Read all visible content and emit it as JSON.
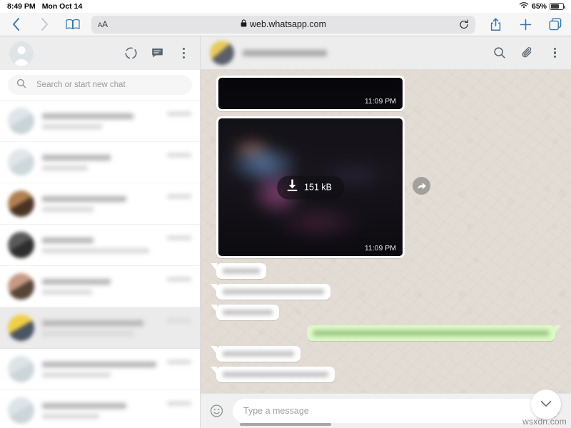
{
  "status_bar": {
    "time": "8:49 PM",
    "date": "Mon Oct 14",
    "battery_percent": "65%",
    "wifi_icon": "wifi-icon",
    "battery_icon": "battery-icon"
  },
  "browser": {
    "back_icon": "chevron-left-icon",
    "forward_icon": "chevron-right-icon",
    "bookmarks_icon": "book-icon",
    "text_size_label": "AA",
    "lock_icon": "lock-icon",
    "url": "web.whatsapp.com",
    "reload_icon": "reload-icon",
    "share_icon": "share-icon",
    "new_tab_icon": "plus-icon",
    "tabs_icon": "tabs-icon"
  },
  "sidebar": {
    "profile_avatar": "user-avatar",
    "status_icon": "status-circle-icon",
    "new_chat_icon": "new-chat-icon",
    "menu_icon": "menu-dots-icon",
    "search": {
      "placeholder": "Search or start new chat",
      "icon": "search-icon",
      "value": ""
    },
    "chats": [
      {
        "name": "",
        "preview": "",
        "time": "",
        "selected": false,
        "avatar_colors": [
          "#dfe5e8",
          "#c9d4d8"
        ]
      },
      {
        "name": "",
        "preview": "",
        "time": "",
        "selected": false,
        "avatar_colors": [
          "#e0e6e9",
          "#cdd8dc"
        ]
      },
      {
        "name": "",
        "preview": "",
        "time": "",
        "selected": false,
        "avatar_colors": [
          "#b08050",
          "#4a3426"
        ]
      },
      {
        "name": "",
        "preview": "",
        "time": "",
        "selected": false,
        "avatar_colors": [
          "#5a5a5a",
          "#2e2e2e"
        ]
      },
      {
        "name": "",
        "preview": "",
        "time": "",
        "selected": false,
        "avatar_colors": [
          "#c89a84",
          "#564538"
        ]
      },
      {
        "name": "",
        "preview": "",
        "time": "",
        "selected": true,
        "avatar_colors": [
          "#f0cf45",
          "#4b5563"
        ]
      },
      {
        "name": "",
        "preview": "",
        "time": "",
        "selected": false,
        "avatar_colors": [
          "#dde4e7",
          "#ccd6da"
        ]
      },
      {
        "name": "",
        "preview": "",
        "time": "",
        "selected": false,
        "avatar_colors": [
          "#dde4e7",
          "#ccd6da"
        ]
      }
    ]
  },
  "chat": {
    "contact_name": "",
    "contact_avatar": "contact-avatar",
    "search_icon": "search-icon",
    "attach_icon": "paperclip-icon",
    "menu_icon": "menu-dots-icon",
    "messages": [
      {
        "type": "media",
        "direction": "in",
        "time": "11:09 PM",
        "clipped": true
      },
      {
        "type": "media",
        "direction": "in",
        "time": "11:09 PM",
        "download_label": "151 kB",
        "download_icon": "download-arrow-icon",
        "forward_icon": "forward-arrow-icon",
        "clipped": false
      },
      {
        "type": "text",
        "direction": "in",
        "text": "",
        "lines": [
          52
        ]
      },
      {
        "type": "text",
        "direction": "in",
        "text": "",
        "lines": [
          142
        ]
      },
      {
        "type": "text",
        "direction": "in",
        "text": "",
        "lines": [
          70
        ]
      },
      {
        "type": "text",
        "direction": "out",
        "text": "",
        "lines": [
          330
        ]
      },
      {
        "type": "text",
        "direction": "in",
        "text": "",
        "lines": [
          100
        ]
      },
      {
        "type": "text",
        "direction": "in",
        "text": "",
        "lines": [
          148
        ]
      }
    ],
    "scroll_down_icon": "chevron-down-icon",
    "composer": {
      "emoji_icon": "emoji-smiley-icon",
      "placeholder": "Type a message",
      "value": "",
      "mic_icon": "microphone-icon"
    }
  },
  "watermark": {
    "text": "wsxdn.com"
  },
  "colors": {
    "chat_background": "#e3dcd4",
    "outgoing_bubble": "#dcf8c6",
    "incoming_bubble": "#ffffff",
    "header_gray": "#ededed",
    "composer_gray": "#f0f0f0",
    "safari_gray": "#f6f6f6",
    "accent_blue": "#3478b8"
  }
}
